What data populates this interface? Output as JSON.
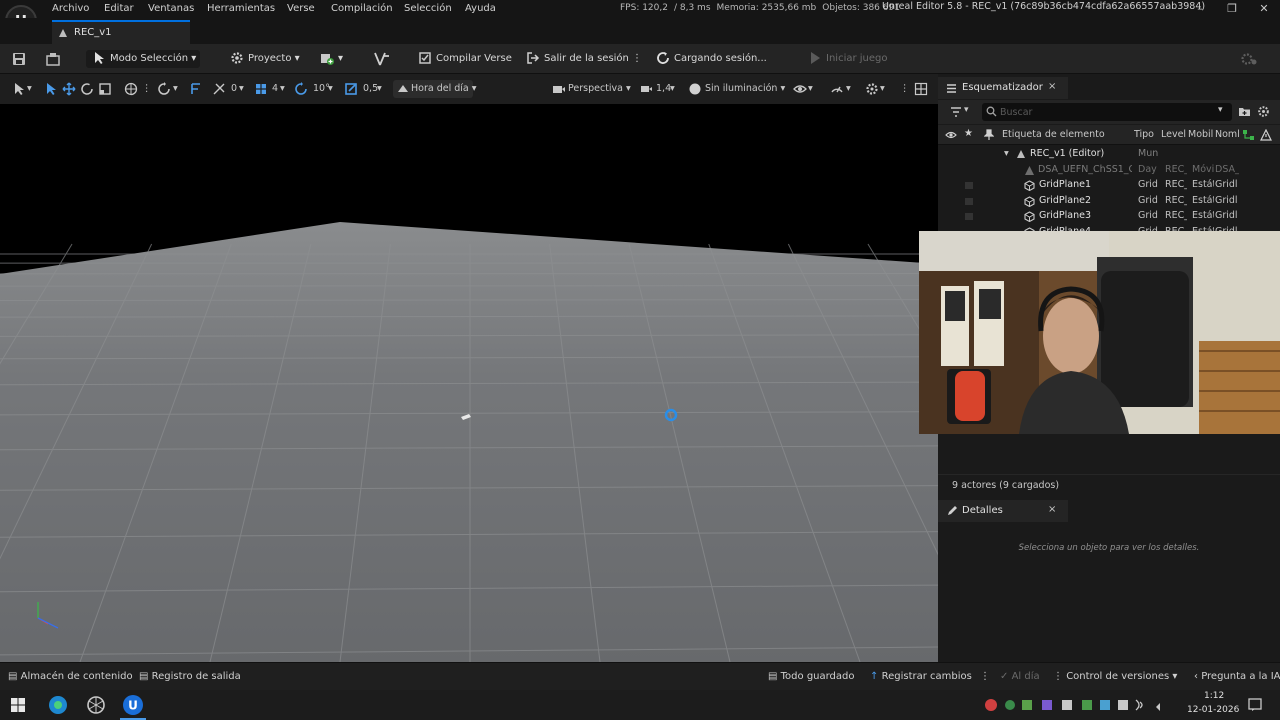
{
  "menu": {
    "items": [
      "Archivo",
      "Editar",
      "Ventanas",
      "Herramientas",
      "Verse",
      "Compilación",
      "Selección",
      "Ayuda"
    ],
    "stats": [
      "FPS: 120,2",
      "/ 8,3 ms",
      "Memoria: 2535,66 mb",
      "Objetos: 386 691"
    ],
    "window_title": "Unreal Editor 5.8 - REC_v1 (76c89b36cb474cdfa62a66557aab3984)",
    "logo": "U"
  },
  "tab": {
    "label": "REC_v1"
  },
  "toolbar": {
    "mode": "Modo Selección",
    "project": "Proyecto",
    "compile": "Compilar Verse",
    "logout": "Salir de la sesión",
    "loading": "Cargando sesión...",
    "play": "Iniciar juego"
  },
  "viewport_toolbar": {
    "grid_snap": "0",
    "angle_count": "4",
    "angle_snap": "10°",
    "scale_snap": "0,5",
    "time_of_day": "Hora del día",
    "perspective": "Perspectiva",
    "fov": "1,4",
    "lighting": "Sin iluminación"
  },
  "outliner": {
    "title": "Esquematizador",
    "close": "×",
    "search_placeholder": "Buscar",
    "columns": [
      "Etiqueta de elemento",
      "Tipo",
      "Level",
      "Mobil",
      "Noml"
    ],
    "rows": [
      {
        "name": "REC_v1 (Editor)",
        "type": "Mun",
        "level": "",
        "mob": "",
        "nom": "",
        "kind": "world"
      },
      {
        "name": "DSA_UEFN_ChSS1_C",
        "type": "Day",
        "level": "REC_",
        "mob": "Móvi",
        "nom": "DSA_",
        "kind": "dim"
      },
      {
        "name": "GridPlane1",
        "type": "Grid",
        "level": "REC_",
        "mob": "Estát",
        "nom": "Gridl",
        "kind": "grid"
      },
      {
        "name": "GridPlane2",
        "type": "Grid",
        "level": "REC_",
        "mob": "Estát",
        "nom": "Gridl",
        "kind": "grid"
      },
      {
        "name": "GridPlane3",
        "type": "Grid",
        "level": "REC_",
        "mob": "Estát",
        "nom": "Gridl",
        "kind": "grid"
      },
      {
        "name": "GridPlane4",
        "type": "Grid",
        "level": "REC_",
        "mob": "Estát",
        "nom": "Gridl",
        "kind": "grid"
      }
    ],
    "actors_count": "9 actores (9 cargados)"
  },
  "details": {
    "title": "Detalles",
    "close": "×",
    "empty_hint": "Selecciona un objeto para ver los detalles."
  },
  "statusbar": {
    "content_drawer": "Almacén de contenido",
    "output_log": "Registro de salida",
    "all_saved": "Todo guardado",
    "register_changes": "Registrar cambios",
    "ai": "Al día",
    "source_control": "Control de versiones",
    "ask_ai": "Pregunta a la IA"
  },
  "taskbar": {
    "time": "1:12",
    "date": "12-01-2026"
  },
  "colors": {
    "accent": "#0070e0",
    "panel": "#1a1a1a",
    "toolbar": "#242424",
    "floor": "#6f7173"
  }
}
